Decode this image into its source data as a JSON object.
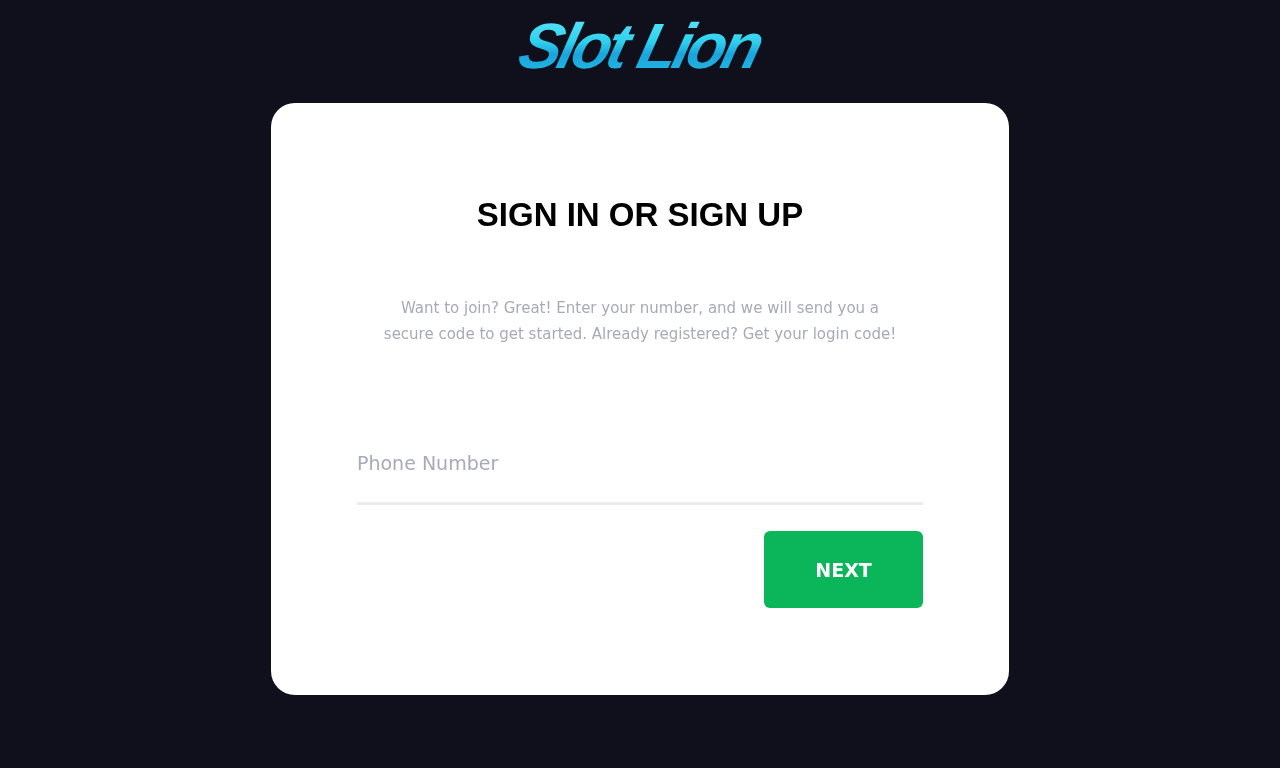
{
  "logo": {
    "text": "Slot Lion"
  },
  "card": {
    "title": "SIGN IN OR SIGN UP",
    "description": "Want to join? Great! Enter your number, and we will send you a secure code to get started. Already registered? Get your login code!",
    "phone_field": {
      "placeholder": "Phone Number"
    },
    "buttons": [
      {
        "label": "NEXT",
        "kind": "primary"
      }
    ]
  }
}
